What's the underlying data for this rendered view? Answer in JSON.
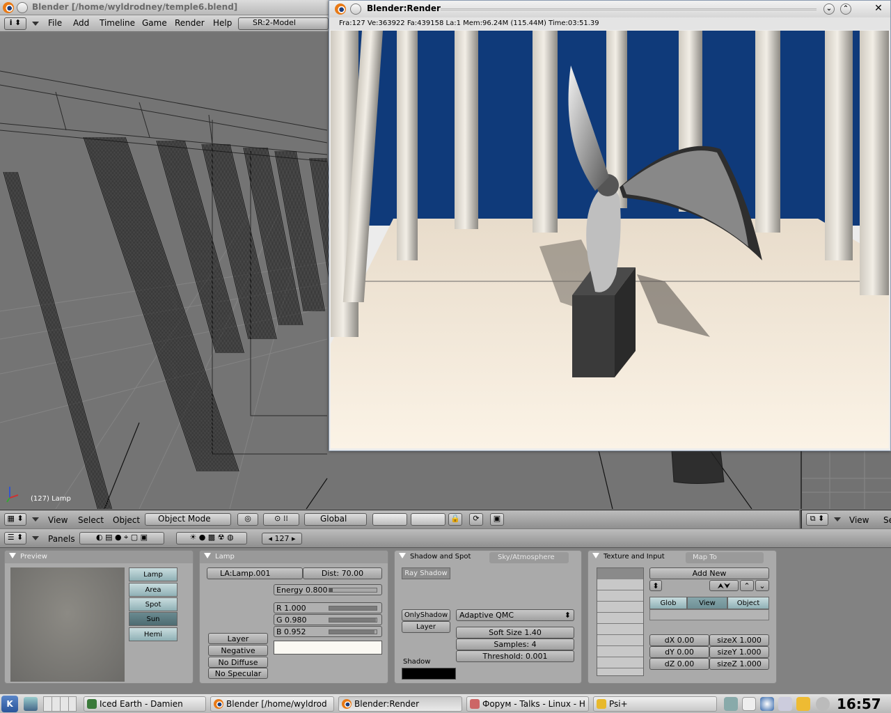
{
  "blender_window": {
    "title": "Blender [/home/wyldrodney/temple6.blend]",
    "menu": [
      "File",
      "Add",
      "Timeline",
      "Game",
      "Render",
      "Help"
    ],
    "scene": "SR:2-Model"
  },
  "viewport": {
    "object_label": "(127) Lamp"
  },
  "view_header": {
    "menus": [
      "View",
      "Select",
      "Object"
    ],
    "mode": "Object Mode",
    "orientation": "Global"
  },
  "right_header": {
    "view_label": "View",
    "truncated": "Se"
  },
  "buttons_header": {
    "panels_label": "Panels",
    "frame": "127"
  },
  "preview_panel": {
    "title": "Preview",
    "lamp_types": [
      "Lamp",
      "Area",
      "Spot",
      "Sun",
      "Hemi"
    ],
    "selected": "Sun"
  },
  "lamp_panel": {
    "title": "Lamp",
    "name": "LA:Lamp.001",
    "dist": "Dist: 70.00",
    "energy": "Energy 0.800",
    "energy_fraction": 0.08,
    "r": "R 1.000",
    "g": "G 0.980",
    "b": "B 0.952",
    "r_fraction": 1.0,
    "g_fraction": 0.98,
    "b_fraction": 0.952,
    "toggles": [
      "Layer",
      "Negative",
      "No Diffuse",
      "No Specular"
    ],
    "color_swatch": "#fbf9f3"
  },
  "shadow_panel": {
    "tab_active": "Shadow and Spot",
    "tab_inactive": "Sky/Atmosphere",
    "ray_shadow": "Ray Shadow",
    "only_shadow": "OnlyShadow",
    "layer": "Layer",
    "sampling": "Adaptive QMC",
    "soft_size": "Soft Size 1.40",
    "samples": "Samples: 4",
    "threshold": "Threshold: 0.001",
    "shadow_label": "Shadow",
    "shadow_color": "#000000"
  },
  "texture_panel": {
    "tab_active": "Texture and Input",
    "tab_inactive": "Map To",
    "add_new": "Add New",
    "coords": [
      "Glob",
      "View",
      "Object"
    ],
    "selected_coord": "View",
    "dx": "dX 0.00",
    "dy": "dY 0.00",
    "dz": "dZ 0.00",
    "sizex": "sizeX 1.000",
    "sizey": "sizeY 1.000",
    "sizez": "sizeZ 1.000"
  },
  "render_window": {
    "title": "Blender:Render",
    "info": "Fra:127  Ve:363922 Fa:439158 La:1 Mem:96.24M (115.44M) Time:03:51.39",
    "sky_color": "#0f3a7a"
  },
  "taskbar": {
    "tasks": [
      "Iced Earth - Damien",
      "Blender [/home/wyldrod",
      "Blender:Render",
      "Форум - Talks - Linux - H",
      "Psi+"
    ],
    "clock": "16:57"
  }
}
